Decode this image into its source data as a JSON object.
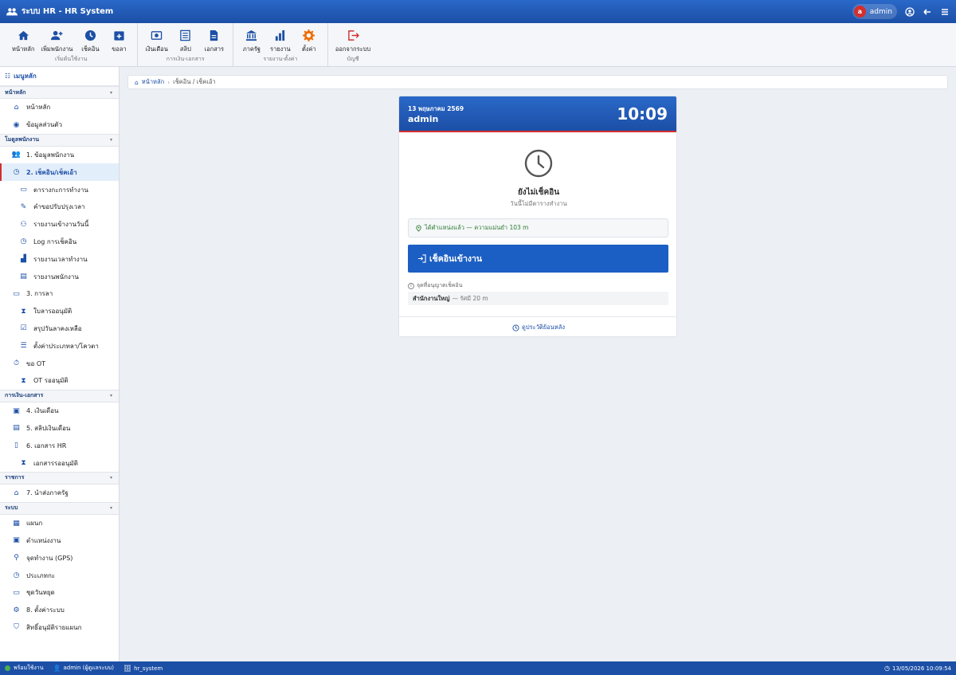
{
  "titlebar": {
    "title": "ระบบ HR -  HR System",
    "avatar_letter": "a",
    "user": "admin"
  },
  "ribbon": {
    "groups": [
      {
        "label": "เริ่มต้นใช้งาน",
        "items": [
          "หน้าหลัก",
          "เพิ่มพนักงาน",
          "เช็คอิน",
          "ขอลา"
        ]
      },
      {
        "label": "การเงิน-เอกสาร",
        "items": [
          "เงินเดือน",
          "สลิป",
          "เอกสาร"
        ]
      },
      {
        "label": "รายงาน-ตั้งค่า",
        "items": [
          "ภาครัฐ",
          "รายงาน",
          "ตั้งค่า"
        ]
      },
      {
        "label": "บัญชี",
        "items": [
          "ออกจากระบบ"
        ]
      }
    ]
  },
  "sidebar": {
    "header": "เมนูหลัก",
    "sections": [
      {
        "title": "หน้าหลัก",
        "items": [
          "หน้าหลัก",
          "ข้อมูลส่วนตัว"
        ]
      },
      {
        "title": "โมดูลพนักงาน",
        "items": [
          "1. ข้อมูลพนักงาน",
          "2. เช็คอิน/เช็คเอ้า",
          "ตารางกะการทำงาน",
          "คำขอปรับปรุงเวลา",
          "รายงานเข้างานวันนี้",
          "Log การเช็คอิน",
          "รายงานเวลาทำงาน",
          "รายงานพนักงาน",
          "3. การลา",
          "ใบลารออนุมัติ",
          "สรุปวันลาคงเหลือ",
          "ตั้งค่าประเภทลา/โควตา",
          "ขอ OT",
          "OT รออนุมัติ"
        ]
      },
      {
        "title": "การเงิน-เอกสาร",
        "items": [
          "4. เงินเดือน",
          "5. สลิปเงินเดือน",
          "6. เอกสาร HR",
          "เอกสารรออนุมัติ"
        ]
      },
      {
        "title": "ราชการ",
        "items": [
          "7. นำส่งภาครัฐ"
        ]
      },
      {
        "title": "ระบบ",
        "items": [
          "แผนก",
          "ตำแหน่งงาน",
          "จุดทำงาน (GPS)",
          "ประเภทกะ",
          "ชุดวันหยุด",
          "8. ตั้งค่าระบบ",
          "สิทธิ์อนุมัติรายแผนก"
        ]
      }
    ]
  },
  "breadcrumb": {
    "home": "หน้าหลัก",
    "current": "เช็คอิน / เช็คเอ้า"
  },
  "card": {
    "date": "13 พฤษภาคม 2569",
    "user": "admin",
    "time": "10:09",
    "status_title": "ยังไม่เช็คอิน",
    "status_sub": "วันนี้ไม่มีตารางทำงาน",
    "gps_text": "ได้ตำแหน่งแล้ว — ความแม่นยำ 103 m",
    "checkin_label": "เช็คอินเข้างาน",
    "allowed_label": "จุดที่อนุญาตเช็คอิน",
    "location_name": "สำนักงานใหญ่",
    "location_radius": "— รัศมี 20 m",
    "history_link": "ดูประวัติย้อนหลัง"
  },
  "statusbar": {
    "ready": "พร้อมใช้งาน",
    "user": "admin (ผู้ดูแลระบบ)",
    "db": "hr_system",
    "datetime": "13/05/2026 10:09:54"
  },
  "colors": {
    "primary": "#1c4fa6",
    "accent_red": "#d32f2f",
    "ok_green": "#2e7d32",
    "orange": "#ef6c00"
  }
}
